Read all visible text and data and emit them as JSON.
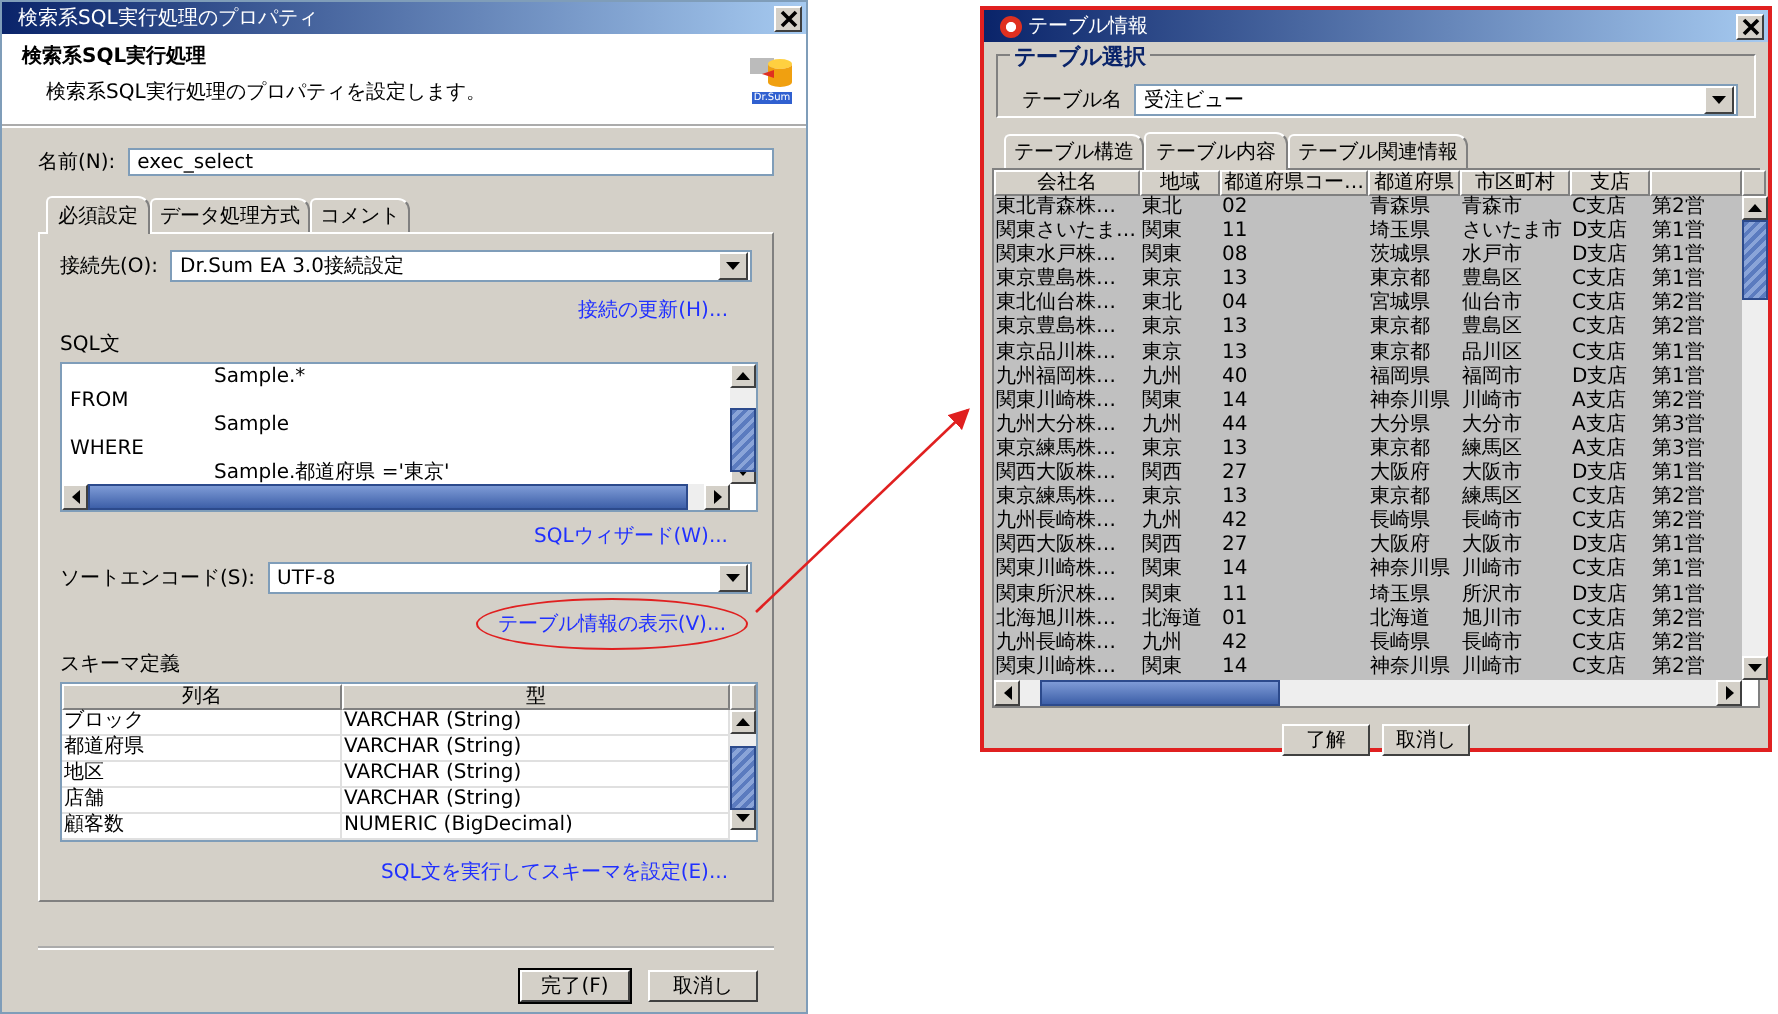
{
  "dialog": {
    "title": "検索系SQL実行処理のプロパティ",
    "heading": "検索系SQL実行処理",
    "description": "検索系SQL実行処理のプロパティを設定します。",
    "logo_caption": "Dr.Sum",
    "name_label": "名前(N):",
    "name_value": "exec_select",
    "tabs": [
      {
        "label": "必須設定",
        "selected": true
      },
      {
        "label": "データ処理方式",
        "selected": false
      },
      {
        "label": "コメント",
        "selected": false
      }
    ],
    "connection_label": "接続先(O):",
    "connection_value": "Dr.Sum EA 3.0接続設定",
    "refresh_link": "接続の更新(H)...",
    "sql_label": "SQL文",
    "sql_lines": [
      {
        "kind": "value",
        "text": "Sample.*"
      },
      {
        "kind": "keyword",
        "text": "FROM"
      },
      {
        "kind": "value",
        "text": "Sample"
      },
      {
        "kind": "keyword",
        "text": "WHERE"
      },
      {
        "kind": "value",
        "text": "Sample.都道府県 ='東京'"
      }
    ],
    "wizard_link": "SQLウィザード(W)...",
    "encode_label": "ソートエンコード(S):",
    "encode_value": "UTF-8",
    "table_info_link": "テーブル情報の表示(V)...",
    "schema_label": "スキーマ定義",
    "schema": {
      "columns": [
        "列名",
        "型"
      ],
      "rows": [
        [
          "ブロック",
          "VARCHAR (String)"
        ],
        [
          "都道府県",
          "VARCHAR (String)"
        ],
        [
          "地区",
          "VARCHAR (String)"
        ],
        [
          "店舗",
          "VARCHAR (String)"
        ],
        [
          "顧客数",
          "NUMERIC (BigDecimal)"
        ]
      ]
    },
    "execute_link": "SQL文を実行してスキーマを設定(E)...",
    "buttons": [
      "完了(F)",
      "取消し"
    ]
  },
  "table_window": {
    "title": "テーブル情報",
    "group_label": "テーブル選択",
    "table_name_label": "テーブル名",
    "table_name_value": "受注ビュー",
    "tabs": [
      {
        "label": "テーブル構造",
        "selected": false
      },
      {
        "label": "テーブル内容",
        "selected": true
      },
      {
        "label": "テーブル関連情報",
        "selected": false
      }
    ],
    "columns": [
      "会社名",
      "地域",
      "都道府県コー…",
      "都道府県",
      "市区町村",
      "支店"
    ],
    "rows": [
      [
        "東北青森株…",
        "東北",
        "02",
        "青森県",
        "青森市",
        "C支店",
        "第2営"
      ],
      [
        "関東さいたま…",
        "関東",
        "11",
        "埼玉県",
        "さいたま市",
        "D支店",
        "第1営"
      ],
      [
        "関東水戸株…",
        "関東",
        "08",
        "茨城県",
        "水戸市",
        "D支店",
        "第1営"
      ],
      [
        "東京豊島株…",
        "東京",
        "13",
        "東京都",
        "豊島区",
        "C支店",
        "第1営"
      ],
      [
        "東北仙台株…",
        "東北",
        "04",
        "宮城県",
        "仙台市",
        "C支店",
        "第2営"
      ],
      [
        "東京豊島株…",
        "東京",
        "13",
        "東京都",
        "豊島区",
        "C支店",
        "第2営"
      ],
      [
        "東京品川株…",
        "東京",
        "13",
        "東京都",
        "品川区",
        "C支店",
        "第1営"
      ],
      [
        "九州福岡株…",
        "九州",
        "40",
        "福岡県",
        "福岡市",
        "D支店",
        "第1営"
      ],
      [
        "関東川崎株…",
        "関東",
        "14",
        "神奈川県",
        "川崎市",
        "A支店",
        "第2営"
      ],
      [
        "九州大分株…",
        "九州",
        "44",
        "大分県",
        "大分市",
        "A支店",
        "第3営"
      ],
      [
        "東京練馬株…",
        "東京",
        "13",
        "東京都",
        "練馬区",
        "A支店",
        "第3営"
      ],
      [
        "関西大阪株…",
        "関西",
        "27",
        "大阪府",
        "大阪市",
        "D支店",
        "第1営"
      ],
      [
        "東京練馬株…",
        "東京",
        "13",
        "東京都",
        "練馬区",
        "C支店",
        "第2営"
      ],
      [
        "九州長崎株…",
        "九州",
        "42",
        "長崎県",
        "長崎市",
        "C支店",
        "第2営"
      ],
      [
        "関西大阪株…",
        "関西",
        "27",
        "大阪府",
        "大阪市",
        "D支店",
        "第1営"
      ],
      [
        "関東川崎株…",
        "関東",
        "14",
        "神奈川県",
        "川崎市",
        "C支店",
        "第1営"
      ],
      [
        "関東所沢株…",
        "関東",
        "11",
        "埼玉県",
        "所沢市",
        "D支店",
        "第1営"
      ],
      [
        "北海旭川株…",
        "北海道",
        "01",
        "北海道",
        "旭川市",
        "C支店",
        "第2営"
      ],
      [
        "九州長崎株…",
        "九州",
        "42",
        "長崎県",
        "長崎市",
        "C支店",
        "第2営"
      ],
      [
        "関東川崎株…",
        "関東",
        "14",
        "神奈川県",
        "川崎市",
        "C支店",
        "第2営"
      ]
    ],
    "buttons": [
      "了解",
      "取消し"
    ]
  }
}
